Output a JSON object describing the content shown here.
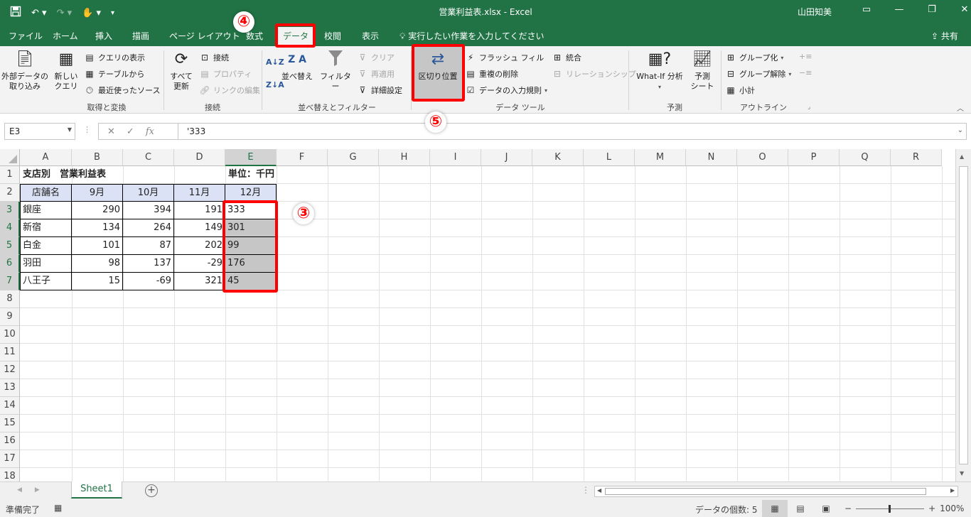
{
  "titlebar": {
    "title": "営業利益表.xlsx  -  Excel",
    "user": "山田知美",
    "qat_icons": [
      "save-icon",
      "undo-icon",
      "redo-icon",
      "touch-mode-icon",
      "customize-icon"
    ]
  },
  "menu": {
    "tabs": [
      "ファイル",
      "ホーム",
      "挿入",
      "描画",
      "ページ レイアウト",
      "数式",
      "データ",
      "校閲",
      "表示"
    ],
    "active_tab": "データ",
    "tell_me": "実行したい作業を入力してください",
    "share": "共有"
  },
  "ribbon": {
    "get_transform": {
      "label": "取得と変換",
      "external_data": "外部データの\n取り込み",
      "new_query": "新しい\nクエリ",
      "show_queries": "クエリの表示",
      "from_table": "テーブルから",
      "recent_sources": "最近使ったソース"
    },
    "connections": {
      "label": "接続",
      "refresh_all": "すべて\n更新",
      "connections": "接続",
      "properties": "プロパティ",
      "edit_links": "リンクの編集"
    },
    "sort_filter": {
      "label": "並べ替えとフィルター",
      "sort": "並べ替え",
      "filter": "フィルター",
      "clear": "クリア",
      "reapply": "再適用",
      "advanced": "詳細設定"
    },
    "data_tools": {
      "label": "データ ツール",
      "text_to_columns": "区切り位置",
      "flash_fill": "フラッシュ フィル",
      "remove_duplicates": "重複の削除",
      "data_validation": "データの入力規則",
      "consolidate": "統合",
      "relationships": "リレーションシップ"
    },
    "forecast": {
      "label": "予測",
      "what_if": "What-If 分析",
      "forecast_sheet": "予測\nシート"
    },
    "outline": {
      "label": "アウトライン",
      "group": "グループ化",
      "ungroup": "グループ解除",
      "subtotal": "小計"
    }
  },
  "formula_bar": {
    "name_box": "E3",
    "formula": "'333"
  },
  "columns": [
    "A",
    "B",
    "C",
    "D",
    "E",
    "F",
    "G",
    "H",
    "I",
    "J",
    "K",
    "L",
    "M",
    "N",
    "O",
    "P",
    "Q",
    "R"
  ],
  "rows": [
    "1",
    "2",
    "3",
    "4",
    "5",
    "6",
    "7",
    "8",
    "9",
    "10",
    "11",
    "12",
    "13",
    "14",
    "15",
    "16",
    "17",
    "18"
  ],
  "sheet": {
    "title": "支店別　営業利益表",
    "unit": "単位：千円",
    "headers": [
      "店舗名",
      "9月",
      "10月",
      "11月",
      "12月"
    ],
    "data": [
      [
        "銀座",
        "290",
        "394",
        "191",
        "333"
      ],
      [
        "新宿",
        "134",
        "264",
        "149",
        "301"
      ],
      [
        "白金",
        "101",
        "87",
        "202",
        "99"
      ],
      [
        "羽田",
        "98",
        "137",
        "-29",
        "176"
      ],
      [
        "八王子",
        "15",
        "-69",
        "321",
        "45"
      ]
    ]
  },
  "sheet_tabs": [
    "Sheet1"
  ],
  "status": {
    "ready": "準備完了",
    "count": "データの個数: 5",
    "zoom": "100%"
  },
  "annotations": {
    "step3": "③",
    "step4": "④",
    "step5": "⑤",
    "highlight_color": "#ff0000"
  },
  "colors": {
    "excel_green": "#217346",
    "header_fill": "#dbe2f5",
    "selection_fill": "#c6c6c6"
  }
}
